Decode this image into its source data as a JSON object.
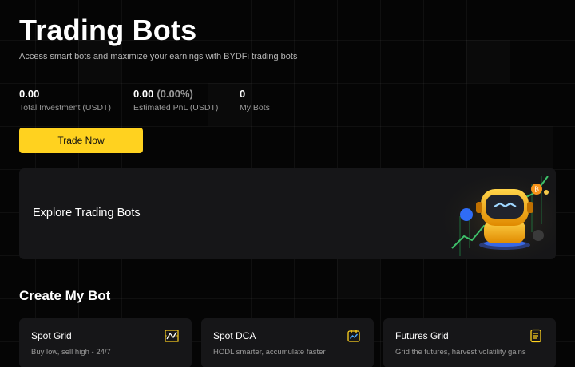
{
  "hero": {
    "title": "Trading Bots",
    "subtitle": "Access smart bots and maximize your earnings with BYDFi trading bots"
  },
  "stats": [
    {
      "value": "0.00",
      "extra": "",
      "label": "Total Investment (USDT)"
    },
    {
      "value": "0.00",
      "extra": "(0.00%)",
      "label": "Estimated PnL (USDT)"
    },
    {
      "value": "0",
      "extra": "",
      "label": "My Bots"
    }
  ],
  "trade_button": {
    "label": "Trade Now"
  },
  "explore": {
    "title": "Explore Trading Bots"
  },
  "create_section": {
    "title": "Create My Bot",
    "bots": [
      {
        "name": "Spot Grid",
        "description": "Buy low, sell high - 24/7",
        "icon": "grid-chart-icon"
      },
      {
        "name": "Spot DCA",
        "description": "HODL smarter, accumulate faster",
        "icon": "calendar-chart-icon"
      },
      {
        "name": "Futures Grid",
        "description": "Grid the futures, harvest volatility gains",
        "icon": "contract-icon"
      }
    ]
  },
  "colors": {
    "accent": "#ffd21f",
    "background": "#050505",
    "card": "#161618",
    "muted_text": "#9a9a9a"
  }
}
